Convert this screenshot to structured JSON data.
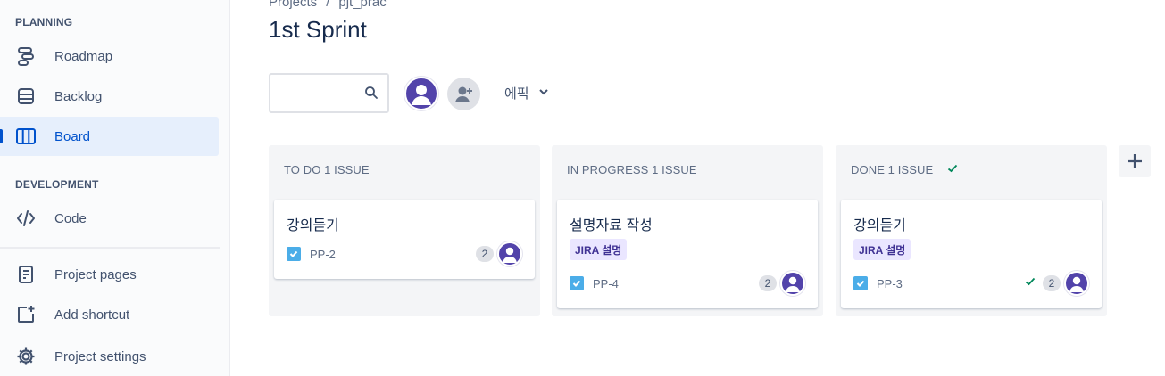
{
  "sidebar": {
    "planning_title": "PLANNING",
    "planning_items": [
      {
        "label": "Roadmap",
        "icon": "roadmap-icon"
      },
      {
        "label": "Backlog",
        "icon": "backlog-icon"
      },
      {
        "label": "Board",
        "icon": "board-icon",
        "active": true
      }
    ],
    "development_title": "DEVELOPMENT",
    "development_items": [
      {
        "label": "Code",
        "icon": "code-icon"
      }
    ],
    "bottom_items": [
      {
        "label": "Project pages",
        "icon": "page-icon"
      },
      {
        "label": "Add shortcut",
        "icon": "add-shortcut-icon"
      },
      {
        "label": "Project settings",
        "icon": "gear-icon"
      }
    ]
  },
  "breadcrumb": {
    "items": [
      "Projects",
      "pjt_prac"
    ],
    "separator": "/"
  },
  "page_title": "1st Sprint",
  "filters": {
    "search_value": "",
    "search_icon": "search-icon",
    "epic_label": "에픽"
  },
  "columns": [
    {
      "title": "TO DO 1 ISSUE",
      "done": false,
      "cards": [
        {
          "title": "강의듣기",
          "epic": "",
          "key": "PP-2",
          "points": "2",
          "done": false
        }
      ]
    },
    {
      "title": "IN PROGRESS 1 ISSUE",
      "done": false,
      "cards": [
        {
          "title": "설명자료 작성",
          "epic": "JIRA 설명",
          "key": "PP-4",
          "points": "2",
          "done": false
        }
      ]
    },
    {
      "title": "DONE 1 ISSUE",
      "done": true,
      "cards": [
        {
          "title": "강의듣기",
          "epic": "JIRA 설명",
          "key": "PP-3",
          "points": "2",
          "done": true
        }
      ]
    }
  ],
  "colors": {
    "accent": "#0052cc",
    "avatar": "#5243aa",
    "epic_bg": "#eae6ff",
    "epic_text": "#403294",
    "task_icon": "#4bade8",
    "done_check": "#00875a"
  }
}
